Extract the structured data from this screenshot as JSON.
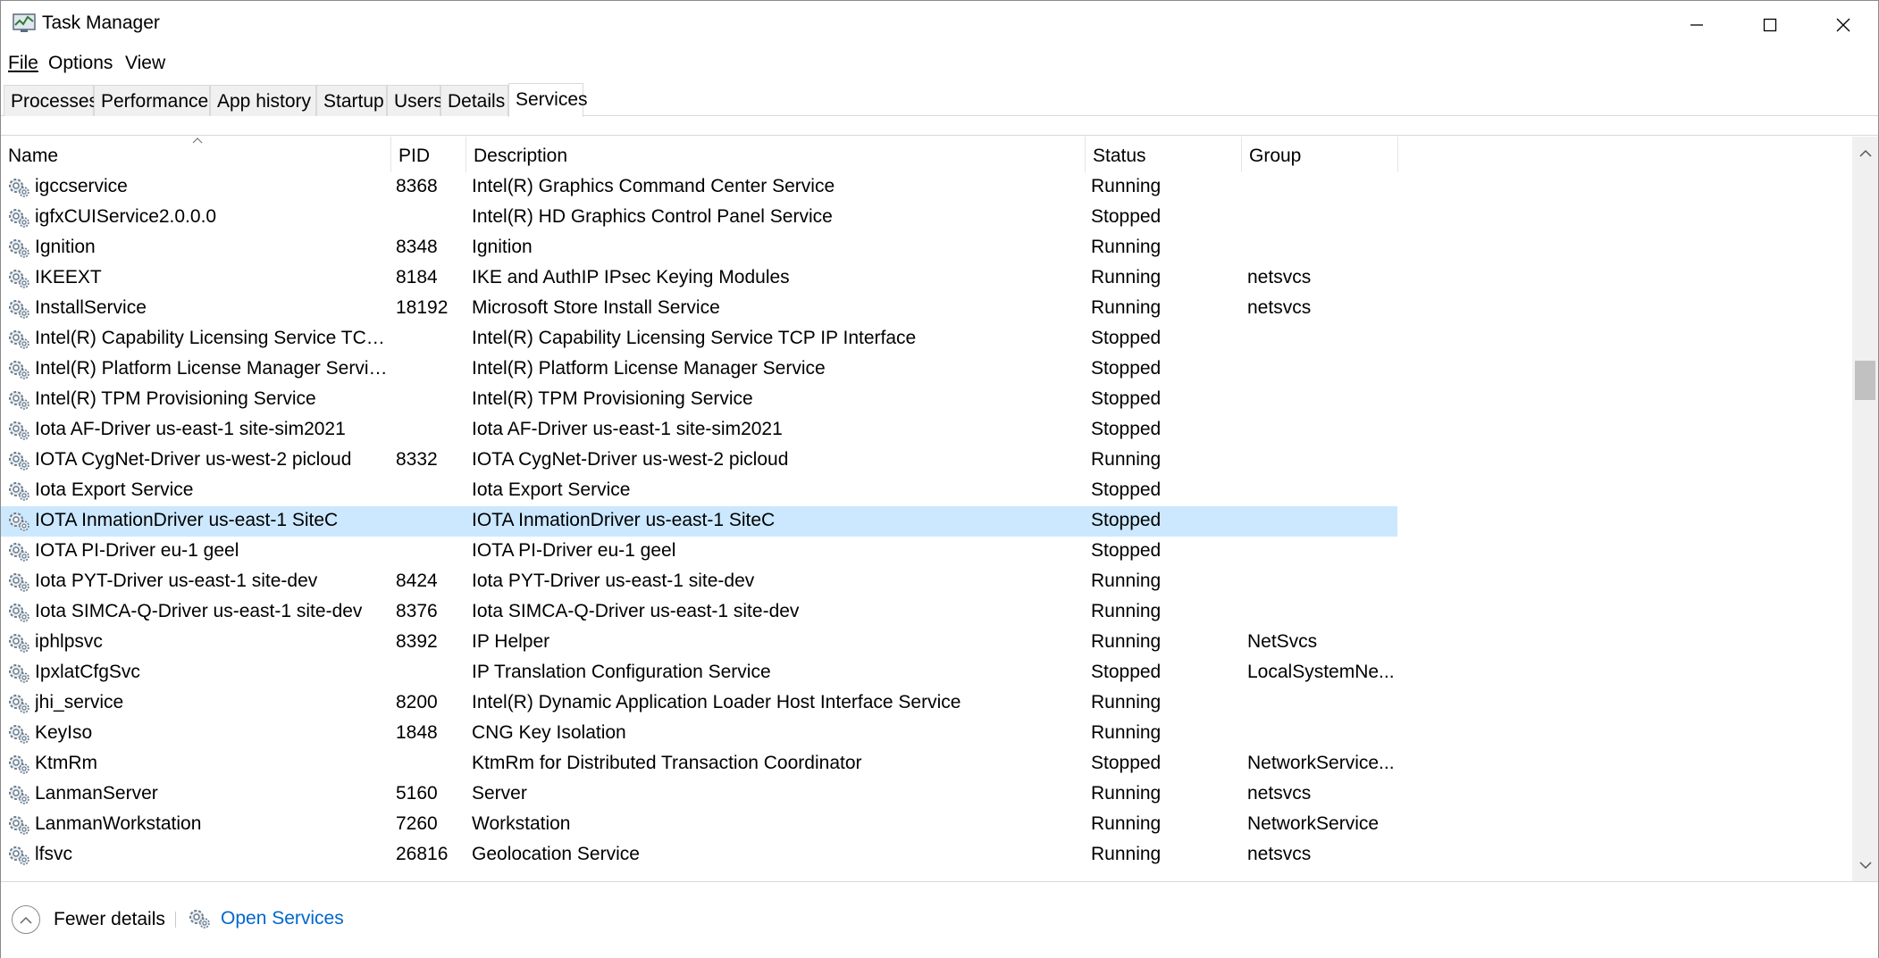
{
  "window": {
    "title": "Task Manager"
  },
  "menu": {
    "file": "File",
    "options": "Options",
    "view": "View"
  },
  "tabs": [
    {
      "label": "Processes",
      "active": false
    },
    {
      "label": "Performance",
      "active": false
    },
    {
      "label": "App history",
      "active": false
    },
    {
      "label": "Startup",
      "active": false
    },
    {
      "label": "Users",
      "active": false
    },
    {
      "label": "Details",
      "active": false
    },
    {
      "label": "Services",
      "active": true
    }
  ],
  "columns": {
    "name": "Name",
    "pid": "PID",
    "description": "Description",
    "status": "Status",
    "group": "Group"
  },
  "sort": {
    "column": "name",
    "direction": "ascending"
  },
  "rows": [
    {
      "name": "igccservice",
      "pid": "8368",
      "description": "Intel(R) Graphics Command Center Service",
      "status": "Running",
      "group": ""
    },
    {
      "name": "igfxCUIService2.0.0.0",
      "pid": "",
      "description": "Intel(R) HD Graphics Control Panel Service",
      "status": "Stopped",
      "group": ""
    },
    {
      "name": "Ignition",
      "pid": "8348",
      "description": "Ignition",
      "status": "Running",
      "group": ""
    },
    {
      "name": "IKEEXT",
      "pid": "8184",
      "description": "IKE and AuthIP IPsec Keying Modules",
      "status": "Running",
      "group": "netsvcs"
    },
    {
      "name": "InstallService",
      "pid": "18192",
      "description": "Microsoft Store Install Service",
      "status": "Running",
      "group": "netsvcs"
    },
    {
      "name": "Intel(R) Capability Licensing Service TCP I...",
      "pid": "",
      "description": "Intel(R) Capability Licensing Service TCP IP Interface",
      "status": "Stopped",
      "group": ""
    },
    {
      "name": "Intel(R) Platform License Manager Service",
      "pid": "",
      "description": "Intel(R) Platform License Manager Service",
      "status": "Stopped",
      "group": ""
    },
    {
      "name": "Intel(R) TPM Provisioning Service",
      "pid": "",
      "description": "Intel(R) TPM Provisioning Service",
      "status": "Stopped",
      "group": ""
    },
    {
      "name": "Iota AF-Driver us-east-1 site-sim2021",
      "pid": "",
      "description": "Iota AF-Driver us-east-1 site-sim2021",
      "status": "Stopped",
      "group": ""
    },
    {
      "name": "IOTA CygNet-Driver us-west-2 picloud",
      "pid": "8332",
      "description": "IOTA CygNet-Driver us-west-2 picloud",
      "status": "Running",
      "group": ""
    },
    {
      "name": "Iota Export Service",
      "pid": "",
      "description": "Iota Export Service",
      "status": "Stopped",
      "group": ""
    },
    {
      "name": "IOTA InmationDriver us-east-1 SiteC",
      "pid": "",
      "description": "IOTA InmationDriver us-east-1 SiteC",
      "status": "Stopped",
      "group": "",
      "selected": true
    },
    {
      "name": "IOTA PI-Driver eu-1 geel",
      "pid": "",
      "description": "IOTA PI-Driver eu-1 geel",
      "status": "Stopped",
      "group": ""
    },
    {
      "name": "Iota PYT-Driver us-east-1 site-dev",
      "pid": "8424",
      "description": "Iota PYT-Driver us-east-1 site-dev",
      "status": "Running",
      "group": ""
    },
    {
      "name": "Iota SIMCA-Q-Driver us-east-1 site-dev",
      "pid": "8376",
      "description": "Iota SIMCA-Q-Driver us-east-1 site-dev",
      "status": "Running",
      "group": ""
    },
    {
      "name": "iphlpsvc",
      "pid": "8392",
      "description": "IP Helper",
      "status": "Running",
      "group": "NetSvcs"
    },
    {
      "name": "IpxlatCfgSvc",
      "pid": "",
      "description": "IP Translation Configuration Service",
      "status": "Stopped",
      "group": "LocalSystemNe..."
    },
    {
      "name": "jhi_service",
      "pid": "8200",
      "description": "Intel(R) Dynamic Application Loader Host Interface Service",
      "status": "Running",
      "group": ""
    },
    {
      "name": "KeyIso",
      "pid": "1848",
      "description": "CNG Key Isolation",
      "status": "Running",
      "group": ""
    },
    {
      "name": "KtmRm",
      "pid": "",
      "description": "KtmRm for Distributed Transaction Coordinator",
      "status": "Stopped",
      "group": "NetworkService..."
    },
    {
      "name": "LanmanServer",
      "pid": "5160",
      "description": "Server",
      "status": "Running",
      "group": "netsvcs"
    },
    {
      "name": "LanmanWorkstation",
      "pid": "7260",
      "description": "Workstation",
      "status": "Running",
      "group": "NetworkService"
    },
    {
      "name": "lfsvc",
      "pid": "26816",
      "description": "Geolocation Service",
      "status": "Running",
      "group": "netsvcs"
    }
  ],
  "footer": {
    "fewer_details": "Fewer details",
    "open_services": "Open Services"
  },
  "scroll": {
    "position_fraction": 0.3
  }
}
